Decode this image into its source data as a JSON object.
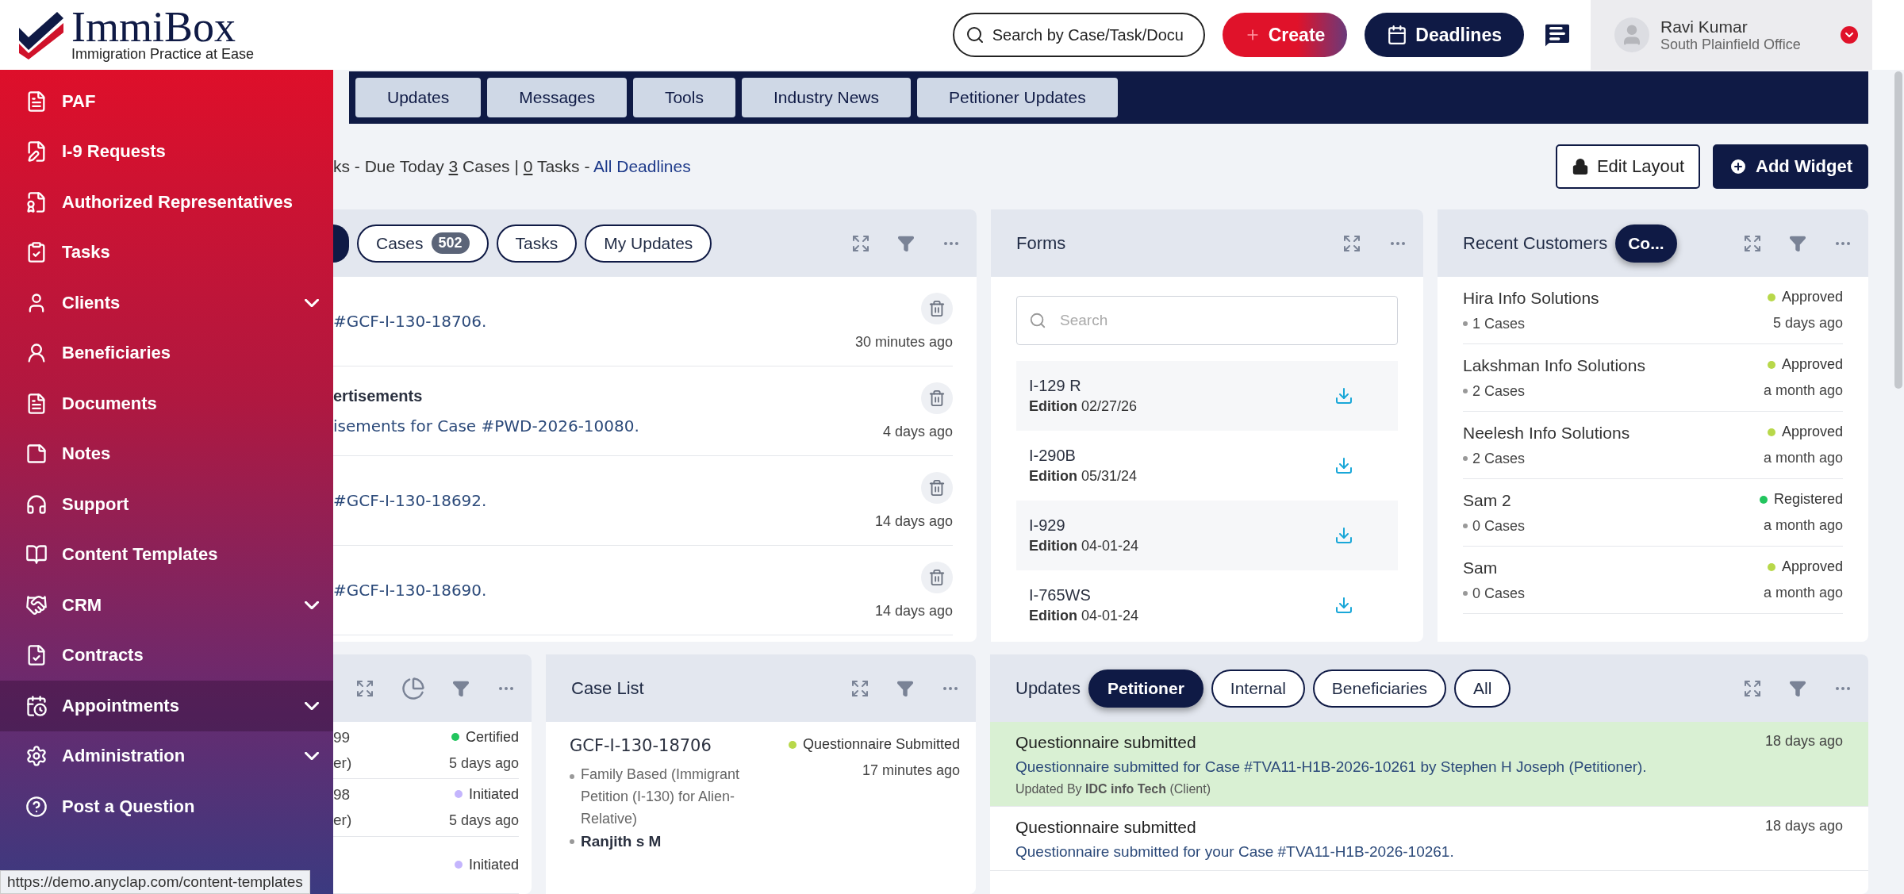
{
  "header": {
    "logo": {
      "name": "ImmiBox",
      "tagline": "Immigration Practice at Ease"
    },
    "search": {
      "placeholder": "Search by Case/Task/Docu"
    },
    "create_button": "Create",
    "deadlines_button": "Deadlines",
    "user": {
      "name": "Ravi Kumar",
      "office": "South Plainfield Office"
    }
  },
  "sidebar": {
    "items": [
      {
        "label": "PAF",
        "has_submenu": false,
        "highlighted": false
      },
      {
        "label": "I-9 Requests",
        "has_submenu": false,
        "highlighted": false
      },
      {
        "label": "Authorized Representatives",
        "has_submenu": false,
        "highlighted": false
      },
      {
        "label": "Tasks",
        "has_submenu": false,
        "highlighted": false
      },
      {
        "label": "Clients",
        "has_submenu": true,
        "highlighted": false
      },
      {
        "label": "Beneficiaries",
        "has_submenu": false,
        "highlighted": false
      },
      {
        "label": "Documents",
        "has_submenu": false,
        "highlighted": false
      },
      {
        "label": "Notes",
        "has_submenu": false,
        "highlighted": false
      },
      {
        "label": "Support",
        "has_submenu": false,
        "highlighted": false
      },
      {
        "label": "Content Templates",
        "has_submenu": false,
        "highlighted": false
      },
      {
        "label": "CRM",
        "has_submenu": true,
        "highlighted": false
      },
      {
        "label": "Contracts",
        "has_submenu": false,
        "highlighted": false
      },
      {
        "label": "Appointments",
        "has_submenu": true,
        "highlighted": true
      },
      {
        "label": "Administration",
        "has_submenu": true,
        "highlighted": false
      },
      {
        "label": "Post a Question",
        "has_submenu": false,
        "highlighted": false
      }
    ]
  },
  "tabs": [
    {
      "label": "Updates",
      "selected": false
    },
    {
      "label": "Messages",
      "selected": false
    },
    {
      "label": "Tools",
      "selected": false
    },
    {
      "label": "Industry News",
      "selected": false
    },
    {
      "label": "Petitioner Updates",
      "selected": false
    }
  ],
  "summary": {
    "lead": "ks - Due Today",
    "cases_count": "3",
    "cases_label": "Cases |",
    "tasks_count": "0",
    "tasks_label": "Tasks -",
    "link": "All Deadlines"
  },
  "edit_layout_button": "Edit Layout",
  "add_widget_button": "Add Widget",
  "activity_widget": {
    "chips": [
      {
        "label": "Cases",
        "count": "502",
        "selected": false
      },
      {
        "label": "Tasks",
        "selected": false
      },
      {
        "label": "My Updates",
        "selected": false
      }
    ],
    "rows": [
      {
        "text": "#GCF-I-130-18706.",
        "time": "30 minutes ago"
      },
      {
        "title": "ertisements",
        "text": "isements for Case #PWD-2026-10080.",
        "time": "4 days ago"
      },
      {
        "text": "#GCF-I-130-18692.",
        "time": "14 days ago"
      },
      {
        "text": "#GCF-I-130-18690.",
        "time": "14 days ago"
      }
    ]
  },
  "forms_widget": {
    "title": "Forms",
    "search": {
      "placeholder": "Search"
    },
    "items": [
      {
        "name": "I-129 R",
        "edition": "**Edition** 02/27/26"
      },
      {
        "name": "I-290B",
        "edition": "**Edition** 05/31/24"
      },
      {
        "name": "I-929",
        "edition": "**Edition** 04-01-24"
      },
      {
        "name": "I-765WS",
        "edition": "**Edition** 04-01-24"
      }
    ]
  },
  "customers_widget": {
    "title": "Recent Customers",
    "chip": {
      "label": "Co...",
      "selected": true
    },
    "items": [
      {
        "name": "Hira Info Solutions",
        "cases": "1 Cases",
        "status": "Approved",
        "color": "#b8d84a",
        "time": "5 days ago"
      },
      {
        "name": "Lakshman Info Solutions",
        "cases": "2 Cases",
        "status": "Approved",
        "color": "#b8d84a",
        "time": "a month ago"
      },
      {
        "name": "Neelesh Info Solutions",
        "cases": "2 Cases",
        "status": "Approved",
        "color": "#b8d84a",
        "time": "a month ago"
      },
      {
        "name": "Sam 2",
        "cases": "0 Cases",
        "status": "Registered",
        "color": "#22c55e",
        "time": "a month ago"
      },
      {
        "name": "Sam",
        "cases": "0 Cases",
        "status": "Approved",
        "color": "#b8d84a",
        "time": "a month ago"
      }
    ]
  },
  "status_widget": {
    "rows": [
      {
        "number": "99",
        "sub": "er)",
        "status": "Certified",
        "color": "#22c55e",
        "time": "5 days ago"
      },
      {
        "number": "98",
        "sub": "er)",
        "status": "Initiated",
        "color": "#c4b5fd",
        "time": "5 days ago"
      },
      {
        "status": "Initiated",
        "color": "#c4b5fd"
      }
    ]
  },
  "case_list_widget": {
    "title": "Case List",
    "items": [
      {
        "case": "GCF-I-130-18706",
        "type": "Family Based (Immigrant Petition (I-130) for Alien-Relative)",
        "person": "Ranjith s M",
        "status": "Questionnaire Submitted",
        "color": "#b8d84a",
        "time": "17 minutes ago"
      }
    ]
  },
  "updates_widget": {
    "title": "Updates",
    "chips": [
      {
        "label": "Petitioner",
        "selected": true
      },
      {
        "label": "Internal",
        "selected": false
      },
      {
        "label": "Beneficiaries",
        "selected": false
      },
      {
        "label": "All",
        "selected": false
      }
    ],
    "items": [
      {
        "title": "Questionnaire submitted",
        "text": "Questionnaire submitted for Case #TVA11-H1B-2026-10261 by Stephen H Joseph (Petitioner).",
        "by": "Updated By **IDC info Tech** (Client)",
        "time": "18 days ago",
        "highlighted": true
      },
      {
        "title": "Questionnaire submitted",
        "text": "Questionnaire submitted for your Case #TVA11-H1B-2026-10261.",
        "time": "18 days ago",
        "highlighted": false
      }
    ]
  },
  "status_bar": {
    "url": "https://demo.anyclap.com/content-templates"
  }
}
